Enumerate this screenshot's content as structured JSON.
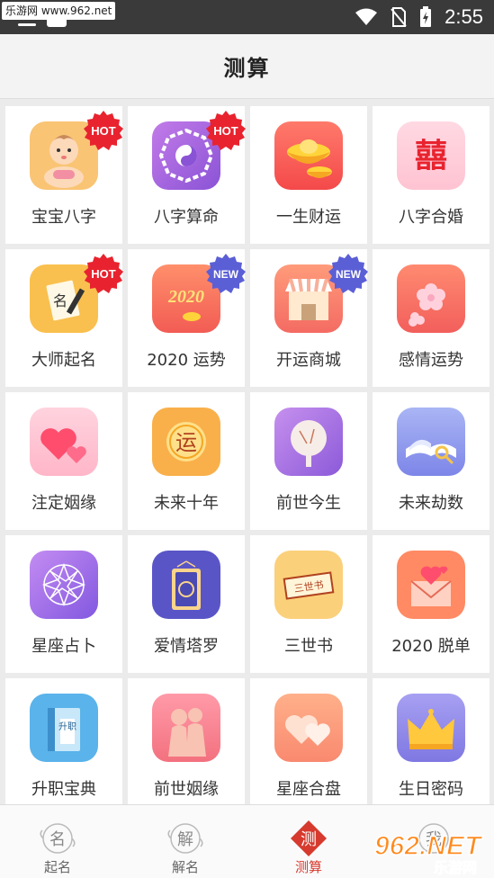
{
  "status_bar": {
    "watermark": "乐游网 www.962.net",
    "time": "2:55"
  },
  "header": {
    "title": "测算"
  },
  "badges": {
    "hot": "HOT",
    "new": "NEW"
  },
  "grid": [
    {
      "label": "宝宝八字",
      "icon": "baby-icon",
      "badge": "hot"
    },
    {
      "label": "八字算命",
      "icon": "bagua-icon",
      "badge": "hot"
    },
    {
      "label": "一生财运",
      "icon": "gold-ingot-icon",
      "badge": ""
    },
    {
      "label": "八字合婚",
      "icon": "double-happiness-icon",
      "badge": ""
    },
    {
      "label": "大师起名",
      "icon": "name-card-icon",
      "badge": "hot"
    },
    {
      "label": "2020 运势",
      "icon": "year-2020-icon",
      "badge": "new"
    },
    {
      "label": "开运商城",
      "icon": "shop-icon",
      "badge": "new"
    },
    {
      "label": "感情运势",
      "icon": "flower-icon",
      "badge": ""
    },
    {
      "label": "注定姻缘",
      "icon": "hearts-icon",
      "badge": ""
    },
    {
      "label": "未来十年",
      "icon": "yun-coin-icon",
      "badge": ""
    },
    {
      "label": "前世今生",
      "icon": "fan-icon",
      "badge": ""
    },
    {
      "label": "未来劫数",
      "icon": "book-icon",
      "badge": ""
    },
    {
      "label": "星座占卜",
      "icon": "star-mandala-icon",
      "badge": ""
    },
    {
      "label": "爱情塔罗",
      "icon": "tarot-card-icon",
      "badge": ""
    },
    {
      "label": "三世书",
      "icon": "scroll-icon",
      "badge": ""
    },
    {
      "label": "2020 脱单",
      "icon": "love-letter-icon",
      "badge": ""
    },
    {
      "label": "升职宝典",
      "icon": "promotion-book-icon",
      "badge": ""
    },
    {
      "label": "前世姻缘",
      "icon": "couple-icon",
      "badge": ""
    },
    {
      "label": "星座合盘",
      "icon": "heart-pair-icon",
      "badge": ""
    },
    {
      "label": "生日密码",
      "icon": "crown-icon",
      "badge": ""
    }
  ],
  "glyphs": {
    "double_happiness": "囍",
    "yun": "运",
    "year": "2020",
    "scroll": "三世书",
    "promotion": "升职",
    "name_card": "名"
  },
  "bottom_nav": [
    {
      "label": "起名",
      "glyph": "名",
      "active": false
    },
    {
      "label": "解名",
      "glyph": "解",
      "active": false
    },
    {
      "label": "测算",
      "glyph": "测",
      "active": true
    },
    {
      "label": "我",
      "glyph": "我",
      "active": false
    }
  ],
  "corner_watermark": {
    "brand": "962.NET",
    "sub": "乐游网"
  },
  "colors": {
    "accent": "#d63a2e",
    "hot": "#e8232f",
    "new": "#5b5fd6"
  }
}
